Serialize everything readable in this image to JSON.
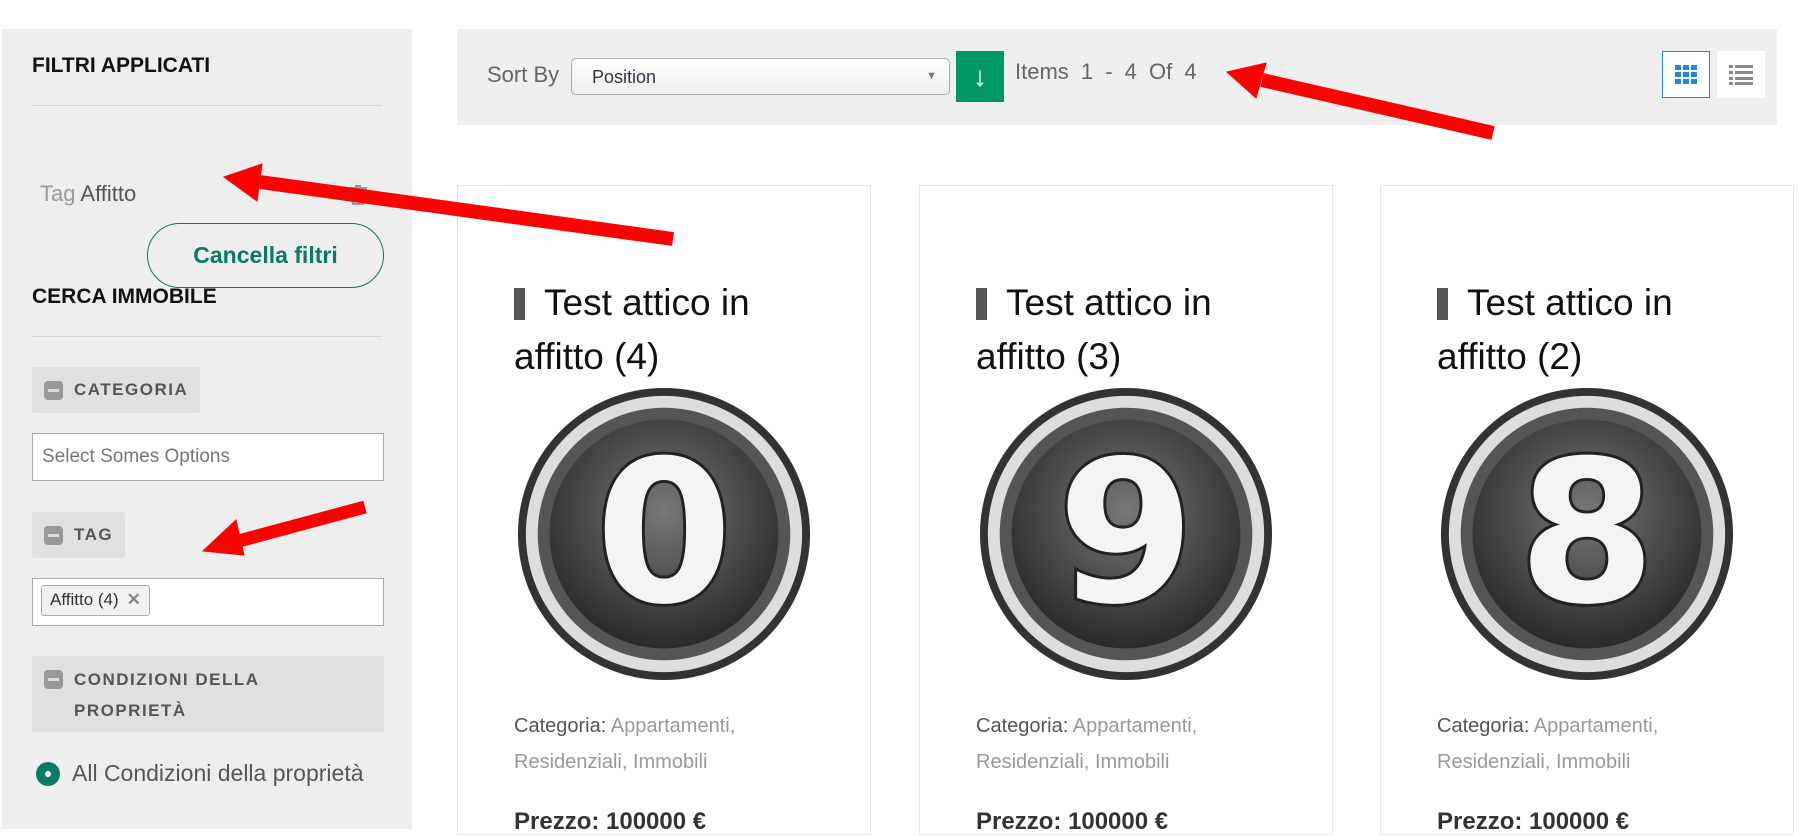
{
  "sidebar": {
    "applied_title": "FILTRI APPLICATI",
    "applied_filter": {
      "label": "Tag",
      "value": "Affitto"
    },
    "clear_button": "Cancella filtri",
    "search_title": "CERCA IMMOBILE",
    "category": {
      "title": "CATEGORIA",
      "placeholder": "Select Somes Options"
    },
    "tag": {
      "title": "TAG",
      "chip": "Affitto (4)",
      "chip_remove": "✕"
    },
    "conditions": {
      "title_line1": "CONDIZIONI DELLA",
      "title_line2": "PROPRIETÀ",
      "option_selected": "All Condizioni della proprietà"
    }
  },
  "toolbar": {
    "sort_label": "Sort By",
    "sort_value": "Position",
    "direction_icon": "↓",
    "items_text": "Items 1 - 4 Of 4"
  },
  "cards": [
    {
      "title": "Test attico in affitto (4)",
      "badge_digit": "0",
      "category_label": "Categoria:",
      "categories": "Appartamenti, Residenziali, Immobili",
      "price": "Prezzo: 100000 €"
    },
    {
      "title": "Test attico in affitto (3)",
      "badge_digit": "9",
      "category_label": "Categoria:",
      "categories": "Appartamenti, Residenziali, Immobili",
      "price": "Prezzo: 100000 €"
    },
    {
      "title": "Test attico in affitto (2)",
      "badge_digit": "8",
      "category_label": "Categoria:",
      "categories": "Appartamenti, Residenziali, Immobili",
      "price": "Prezzo: 100000 €"
    }
  ],
  "colors": {
    "accent": "#0a7a66",
    "sort_button": "#009966",
    "annotation_arrow": "#ff0000",
    "grid_icon": "#1e88e5"
  }
}
